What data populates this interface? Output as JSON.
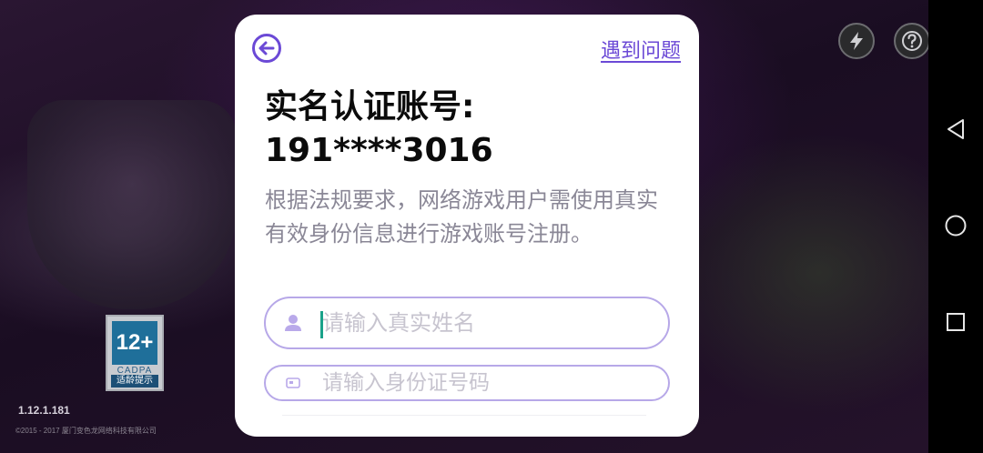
{
  "dialog": {
    "help_link": "遇到问题",
    "title_line1": "实名认证账号:",
    "title_line2": "191****3016",
    "description": "根据法规要求，网络游戏用户需使用真实有效身份信息进行游戏账号注册。",
    "name_field": {
      "placeholder": "请输入真实姓名",
      "value": ""
    },
    "id_field": {
      "placeholder": "请输入身份证号码",
      "value": ""
    },
    "accent_color": "#6b49d6"
  },
  "background": {
    "age_badge": {
      "rating": "12+",
      "org": "CADPA",
      "tip": "适龄提示"
    },
    "version": "1.12.1.181",
    "copyright": "©2015 - 2017 厦门变色龙网络科技有限公司"
  },
  "icons": {
    "top": [
      "lightning-icon",
      "question-icon"
    ],
    "nav": [
      "back-triangle-icon",
      "home-circle-icon",
      "recents-square-icon"
    ]
  }
}
